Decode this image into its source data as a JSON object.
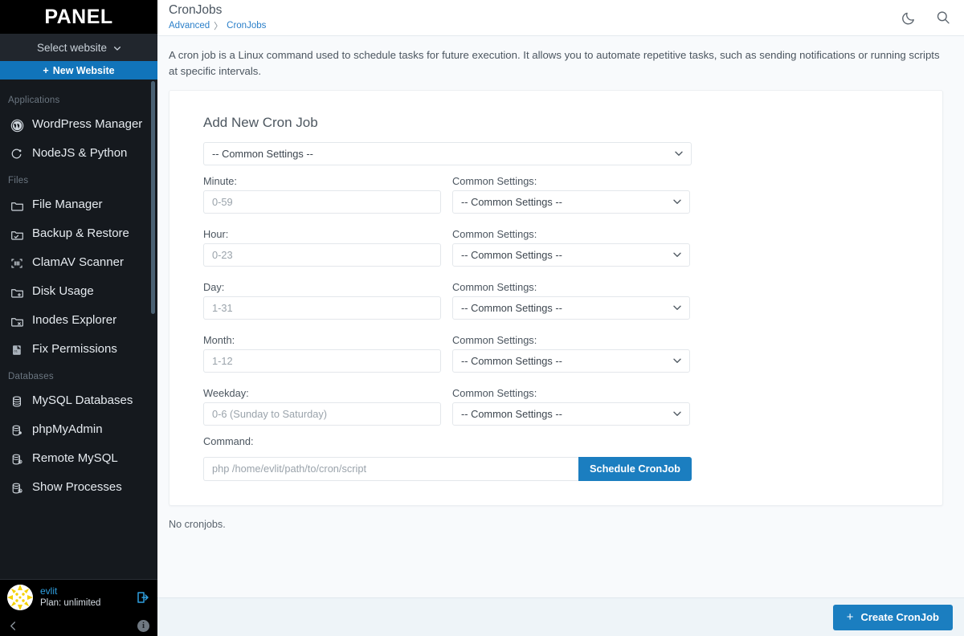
{
  "sidebar": {
    "brand": "PANEL",
    "site_selector": "Select website",
    "new_website": "New Website",
    "sections": [
      {
        "label": "Applications",
        "items": [
          {
            "label": "WordPress Manager",
            "icon": "wordpress-icon"
          },
          {
            "label": "NodeJS & Python",
            "icon": "node-python-icon"
          }
        ]
      },
      {
        "label": "Files",
        "items": [
          {
            "label": "File Manager",
            "icon": "folder-icon"
          },
          {
            "label": "Backup & Restore",
            "icon": "folder-check-icon"
          },
          {
            "label": "ClamAV Scanner",
            "icon": "scan-icon"
          },
          {
            "label": "Disk Usage",
            "icon": "folder-plus-icon"
          },
          {
            "label": "Inodes Explorer",
            "icon": "folder-x-icon"
          },
          {
            "label": "Fix Permissions",
            "icon": "permissions-icon"
          }
        ]
      },
      {
        "label": "Databases",
        "items": [
          {
            "label": "MySQL Databases",
            "icon": "database-icon"
          },
          {
            "label": "phpMyAdmin",
            "icon": "database-dot-icon"
          },
          {
            "label": "Remote MySQL",
            "icon": "database-info-icon"
          },
          {
            "label": "Show Processes",
            "icon": "database-block-icon"
          }
        ]
      }
    ],
    "user": {
      "name": "evlit",
      "plan": "Plan: unlimited"
    },
    "info_glyph": "i"
  },
  "header": {
    "title": "CronJobs",
    "breadcrumb": [
      {
        "label": "Advanced"
      },
      {
        "label": "CronJobs"
      }
    ],
    "separator": "〉",
    "dark_mode_icon": "moon-icon",
    "search_icon": "search-icon"
  },
  "intro": {
    "text": "A cron job is a Linux command used to schedule tasks for future execution. It allows you to automate repetitive tasks, such as sending notifications or running scripts at specific intervals."
  },
  "form": {
    "heading": "Add New Cron Job",
    "common_settings_value": "-- Common Settings --",
    "rows": [
      {
        "label": "Minute:",
        "placeholder": "0-59",
        "select_label": "Common Settings:",
        "select_value": "-- Common Settings --"
      },
      {
        "label": "Hour:",
        "placeholder": "0-23",
        "select_label": "Common Settings:",
        "select_value": "-- Common Settings --"
      },
      {
        "label": "Day:",
        "placeholder": "1-31",
        "select_label": "Common Settings:",
        "select_value": "-- Common Settings --"
      },
      {
        "label": "Month:",
        "placeholder": "1-12",
        "select_label": "Common Settings:",
        "select_value": "-- Common Settings --"
      },
      {
        "label": "Weekday:",
        "placeholder": "0-6 (Sunday to Saturday)",
        "select_label": "Common Settings:",
        "select_value": "-- Common Settings --"
      }
    ],
    "command_label": "Command:",
    "command_placeholder": "php /home/evlit/path/to/cron/script",
    "schedule_button": "Schedule CronJob"
  },
  "list": {
    "empty_text": "No cronjobs."
  },
  "footer": {
    "create_button": "Create CronJob",
    "plus": "+"
  },
  "colors": {
    "accent_blue": "#1b7ec0",
    "sidebar_bg": "#15191e",
    "link_blue": "#2a7fc9",
    "avatar_yellow": "#f5d100"
  }
}
